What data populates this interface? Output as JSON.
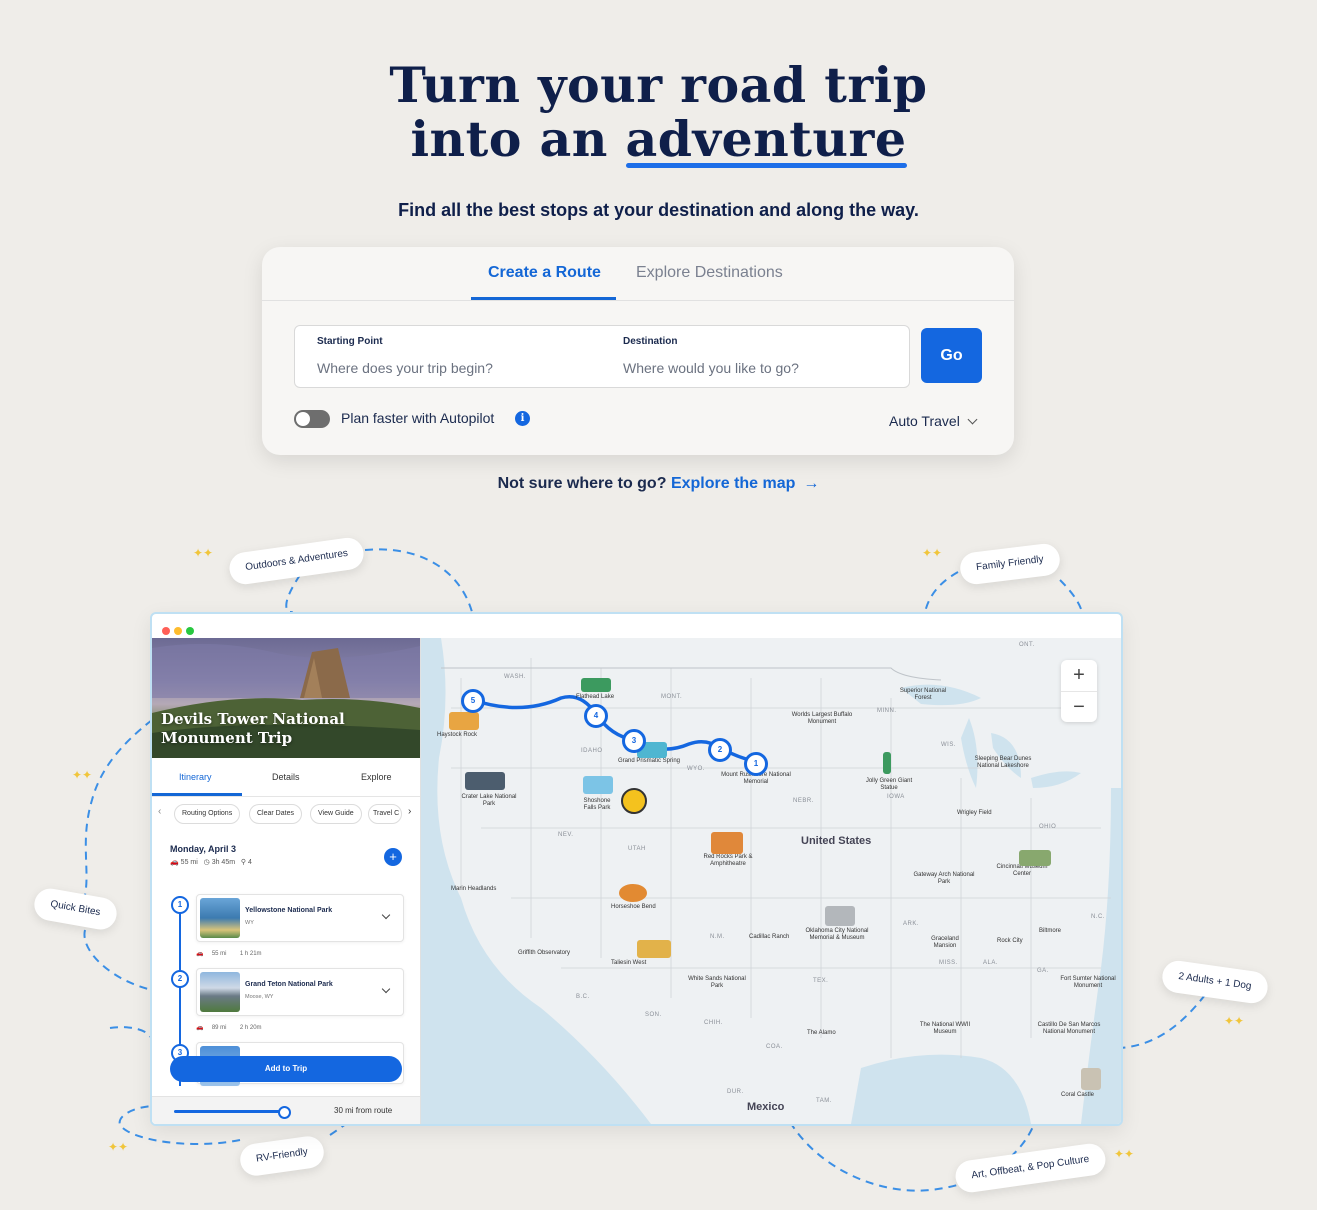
{
  "hero": {
    "title_line1": "Turn your road trip",
    "title_line2_prefix": "into an ",
    "title_line2_emphasis": "adventure",
    "subtitle": "Find all the best stops at your destination and along the way."
  },
  "planner": {
    "tabs": [
      {
        "label": "Create a Route"
      },
      {
        "label": "Explore Destinations"
      }
    ],
    "starting_point": {
      "label": "Starting Point",
      "placeholder": "Where does your trip begin?"
    },
    "destination": {
      "label": "Destination",
      "placeholder": "Where would you like to go?"
    },
    "go_label": "Go",
    "autopilot_label": "Plan faster with Autopilot",
    "info_glyph": "i",
    "travel_mode": "Auto Travel"
  },
  "explore": {
    "question": "Not sure where to go?",
    "link": "Explore the map",
    "arrow": "→"
  },
  "pills": [
    {
      "label": "Outdoors & Adventures"
    },
    {
      "label": "Family Friendly"
    },
    {
      "label": "Quick Bites"
    },
    {
      "label": "2 Adults + 1 Dog"
    },
    {
      "label": "RV-Friendly"
    },
    {
      "label": "Art, Offbeat, & Pop Culture"
    }
  ],
  "window_dots": {
    "colors": [
      "#ff5f57",
      "#febc2e",
      "#28c840"
    ]
  },
  "sidebar": {
    "trip_title_line1": "Devils Tower National",
    "trip_title_line2": "Monument Trip",
    "tabs": [
      {
        "label": "Itinerary"
      },
      {
        "label": "Details"
      },
      {
        "label": "Explore"
      }
    ],
    "chips": [
      {
        "label": "Routing Options"
      },
      {
        "label": "Clear Dates"
      },
      {
        "label": "View Guide"
      },
      {
        "label": "Travel C"
      }
    ],
    "day": {
      "title": "Monday, April 3",
      "distance": "55 mi",
      "duration": "3h 45m",
      "stops": "4"
    },
    "add_glyph": "+",
    "stops": [
      {
        "num": "1",
        "name": "Yellowstone National Park",
        "location": "WY",
        "distance": "55 mi",
        "time": "1 h 21m"
      },
      {
        "num": "2",
        "name": "Grand Teton National Park",
        "location": "Moose, WY",
        "distance": "89 mi",
        "time": "2 h 20m"
      },
      {
        "num": "3"
      }
    ],
    "add_to_trip": "Add to Trip",
    "route_radius": "30 mi from route",
    "route_radius_fraction": 0.45
  },
  "map": {
    "zoom_in": "+",
    "zoom_out": "−",
    "markers": [
      "5",
      "4",
      "3",
      "2",
      "1"
    ],
    "places": [
      "Flathead Lake",
      "Haystock Rock",
      "Grand Prismatic Spring",
      "Mount Rushmore National Memorial",
      "Worlds Largest Buffalo Monument",
      "Superior National Forest",
      "Crater Lake National Park",
      "Shoshone Falls Park",
      "Jolly Green Giant Statue",
      "Sleeping Bear Dunes National Lakeshore",
      "Wrigley Field",
      "Red Rocks Park & Amphitheatre",
      "Cincinnati Museum Center",
      "Gateway Arch National Park",
      "Marin Headlands",
      "Horseshoe Bend",
      "Cadillac Ranch",
      "Oklahoma City National Memorial & Museum",
      "Graceland Mansion",
      "Rock City",
      "Biltmore",
      "Griffith Observatory",
      "Taliesin West",
      "White Sands National Park",
      "Fort Sumter National Monument",
      "The Alamo",
      "The National WWII Museum",
      "Castillo De San Marcos National Monument",
      "Coral Castle"
    ],
    "states": [
      "WASH.",
      "MONT.",
      "IDAHO",
      "WYO.",
      "NEV.",
      "UTAH",
      "N.M.",
      "TEX.",
      "NEBR.",
      "IOWA",
      "MINN.",
      "WIS.",
      "OHIO",
      "ARK.",
      "MISS.",
      "ALA.",
      "ONT.",
      "SON.",
      "CHIH.",
      "COA.",
      "DUR.",
      "TAM.",
      "B.C.",
      "N.C.",
      "GA."
    ],
    "countries": [
      "United States",
      "Mexico"
    ]
  }
}
